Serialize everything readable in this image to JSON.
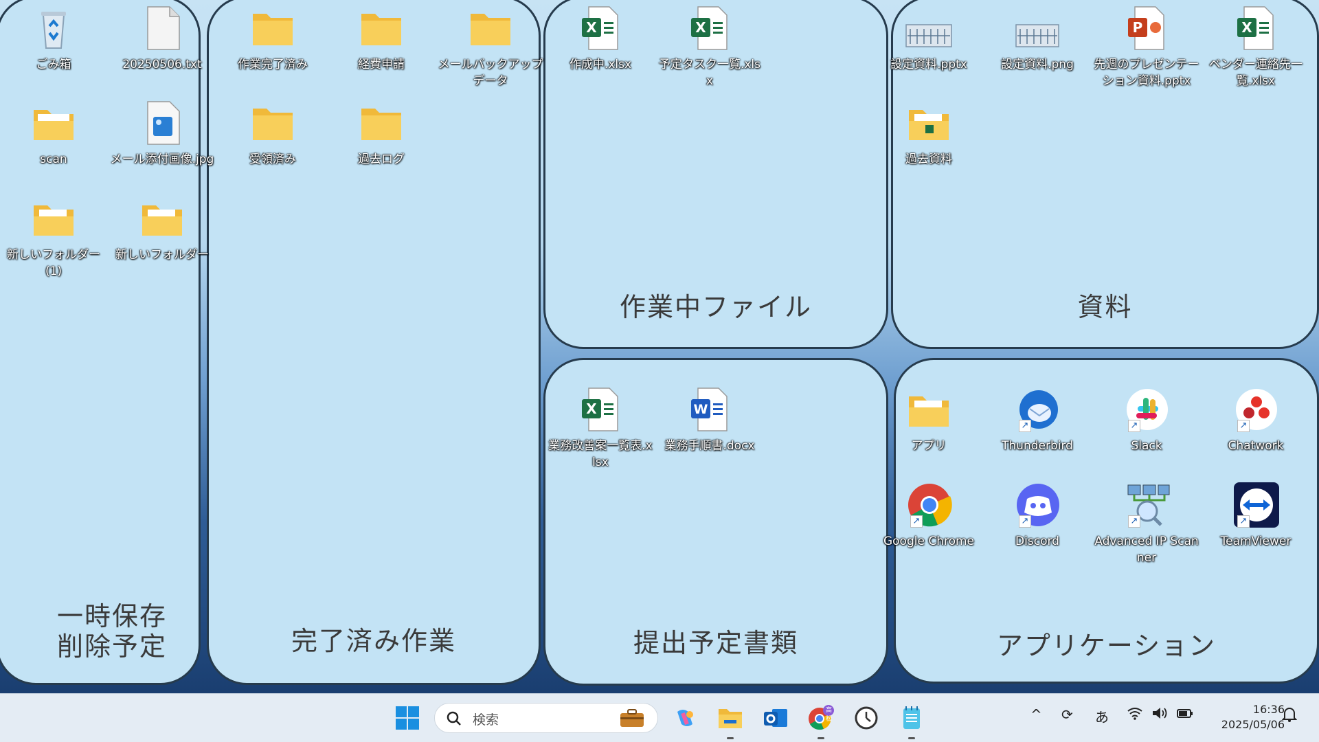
{
  "fences": {
    "temp": {
      "title": "一時保存\n削除予定"
    },
    "done": {
      "title": "完了済み作業"
    },
    "working": {
      "title": "作業中ファイル"
    },
    "materials": {
      "title": "資料"
    },
    "submit": {
      "title": "提出予定書類"
    },
    "apps": {
      "title": "アプリケーション"
    }
  },
  "icons": {
    "recycle": "ごみ箱",
    "txt": "20250506.txt",
    "scan": "scan",
    "mailimg": "メール添付画像.jpg",
    "newfolder1": "新しいフォルダー (1)",
    "newfolder": "新しいフォルダー",
    "work_done": "作業完了済み",
    "expense": "経費申請",
    "mail_backup": "メールバックアップデータ",
    "received": "受領済み",
    "past_log": "過去ログ",
    "creating": "作成中.xlsx",
    "task_list": "予定タスク一覧.xlsx",
    "setting_pptx": "設定資料.pptx",
    "setting_png": "設定資料.png",
    "last_week_pres": "先週のプレゼンテーション資料.pptx",
    "vendor_list": "ベンダー連絡先一覧.xlsx",
    "past_materials": "過去資料",
    "improve_list": "業務改善案一覧表.xlsx",
    "manual": "業務手順書.docx",
    "apps_folder": "アプリ",
    "thunderbird": "Thunderbird",
    "slack": "Slack",
    "chatwork": "Chatwork",
    "chrome": "Google Chrome",
    "discord": "Discord",
    "advanced_ip": "Advanced IP Scanner",
    "teamviewer": "TeamViewer"
  },
  "taskbar": {
    "search_placeholder": "検索",
    "ime": "あ",
    "time": "16:36",
    "date": "2025/05/06",
    "chrome_badge": "高松"
  },
  "colors": {
    "excel": "#1d7044",
    "word": "#1f5bc0",
    "powerpoint": "#c43e1c",
    "folder": "#f6c443",
    "fence_bg": "#c3e3f5",
    "fence_border": "#263b4d"
  }
}
